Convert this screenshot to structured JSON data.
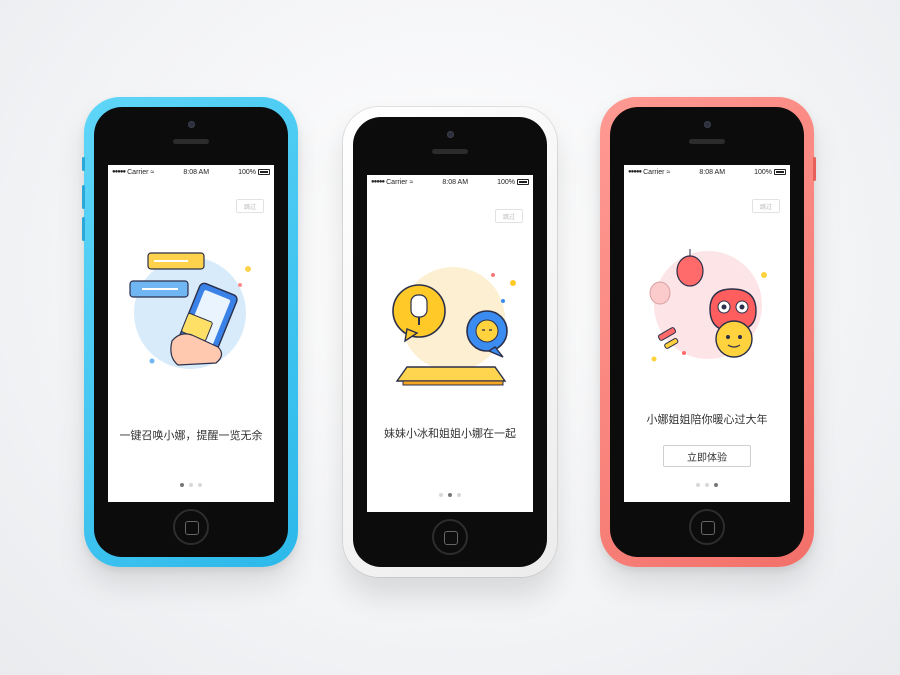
{
  "phones": [
    {
      "color": "#37c6f2",
      "status": {
        "carrier": "Carrier",
        "time": "8:08 AM",
        "battery": "100%"
      },
      "skip_label": "跳过",
      "illustration": "hand-holding-phone-with-chat-bubbles",
      "caption": "一键召唤小娜，提醒一览无余",
      "page_index": 1,
      "page_count": 3
    },
    {
      "color": "#ffffff",
      "status": {
        "carrier": "Carrier",
        "time": "8:08 AM",
        "battery": "100%"
      },
      "skip_label": "跳过",
      "illustration": "popsicle-and-face-chat-bubbles-over-phone",
      "caption": "妹妹小冰和姐姐小娜在一起",
      "page_index": 2,
      "page_count": 3
    },
    {
      "color": "#f77f78",
      "status": {
        "carrier": "Carrier",
        "time": "8:08 AM",
        "battery": "100%"
      },
      "skip_label": "跳过",
      "illustration": "lion-dance-mascot-with-lanterns-and-firecrackers",
      "caption": "小娜姐姐陪你暖心过大年",
      "cta_label": "立即体验",
      "page_index": 3,
      "page_count": 3
    }
  ]
}
